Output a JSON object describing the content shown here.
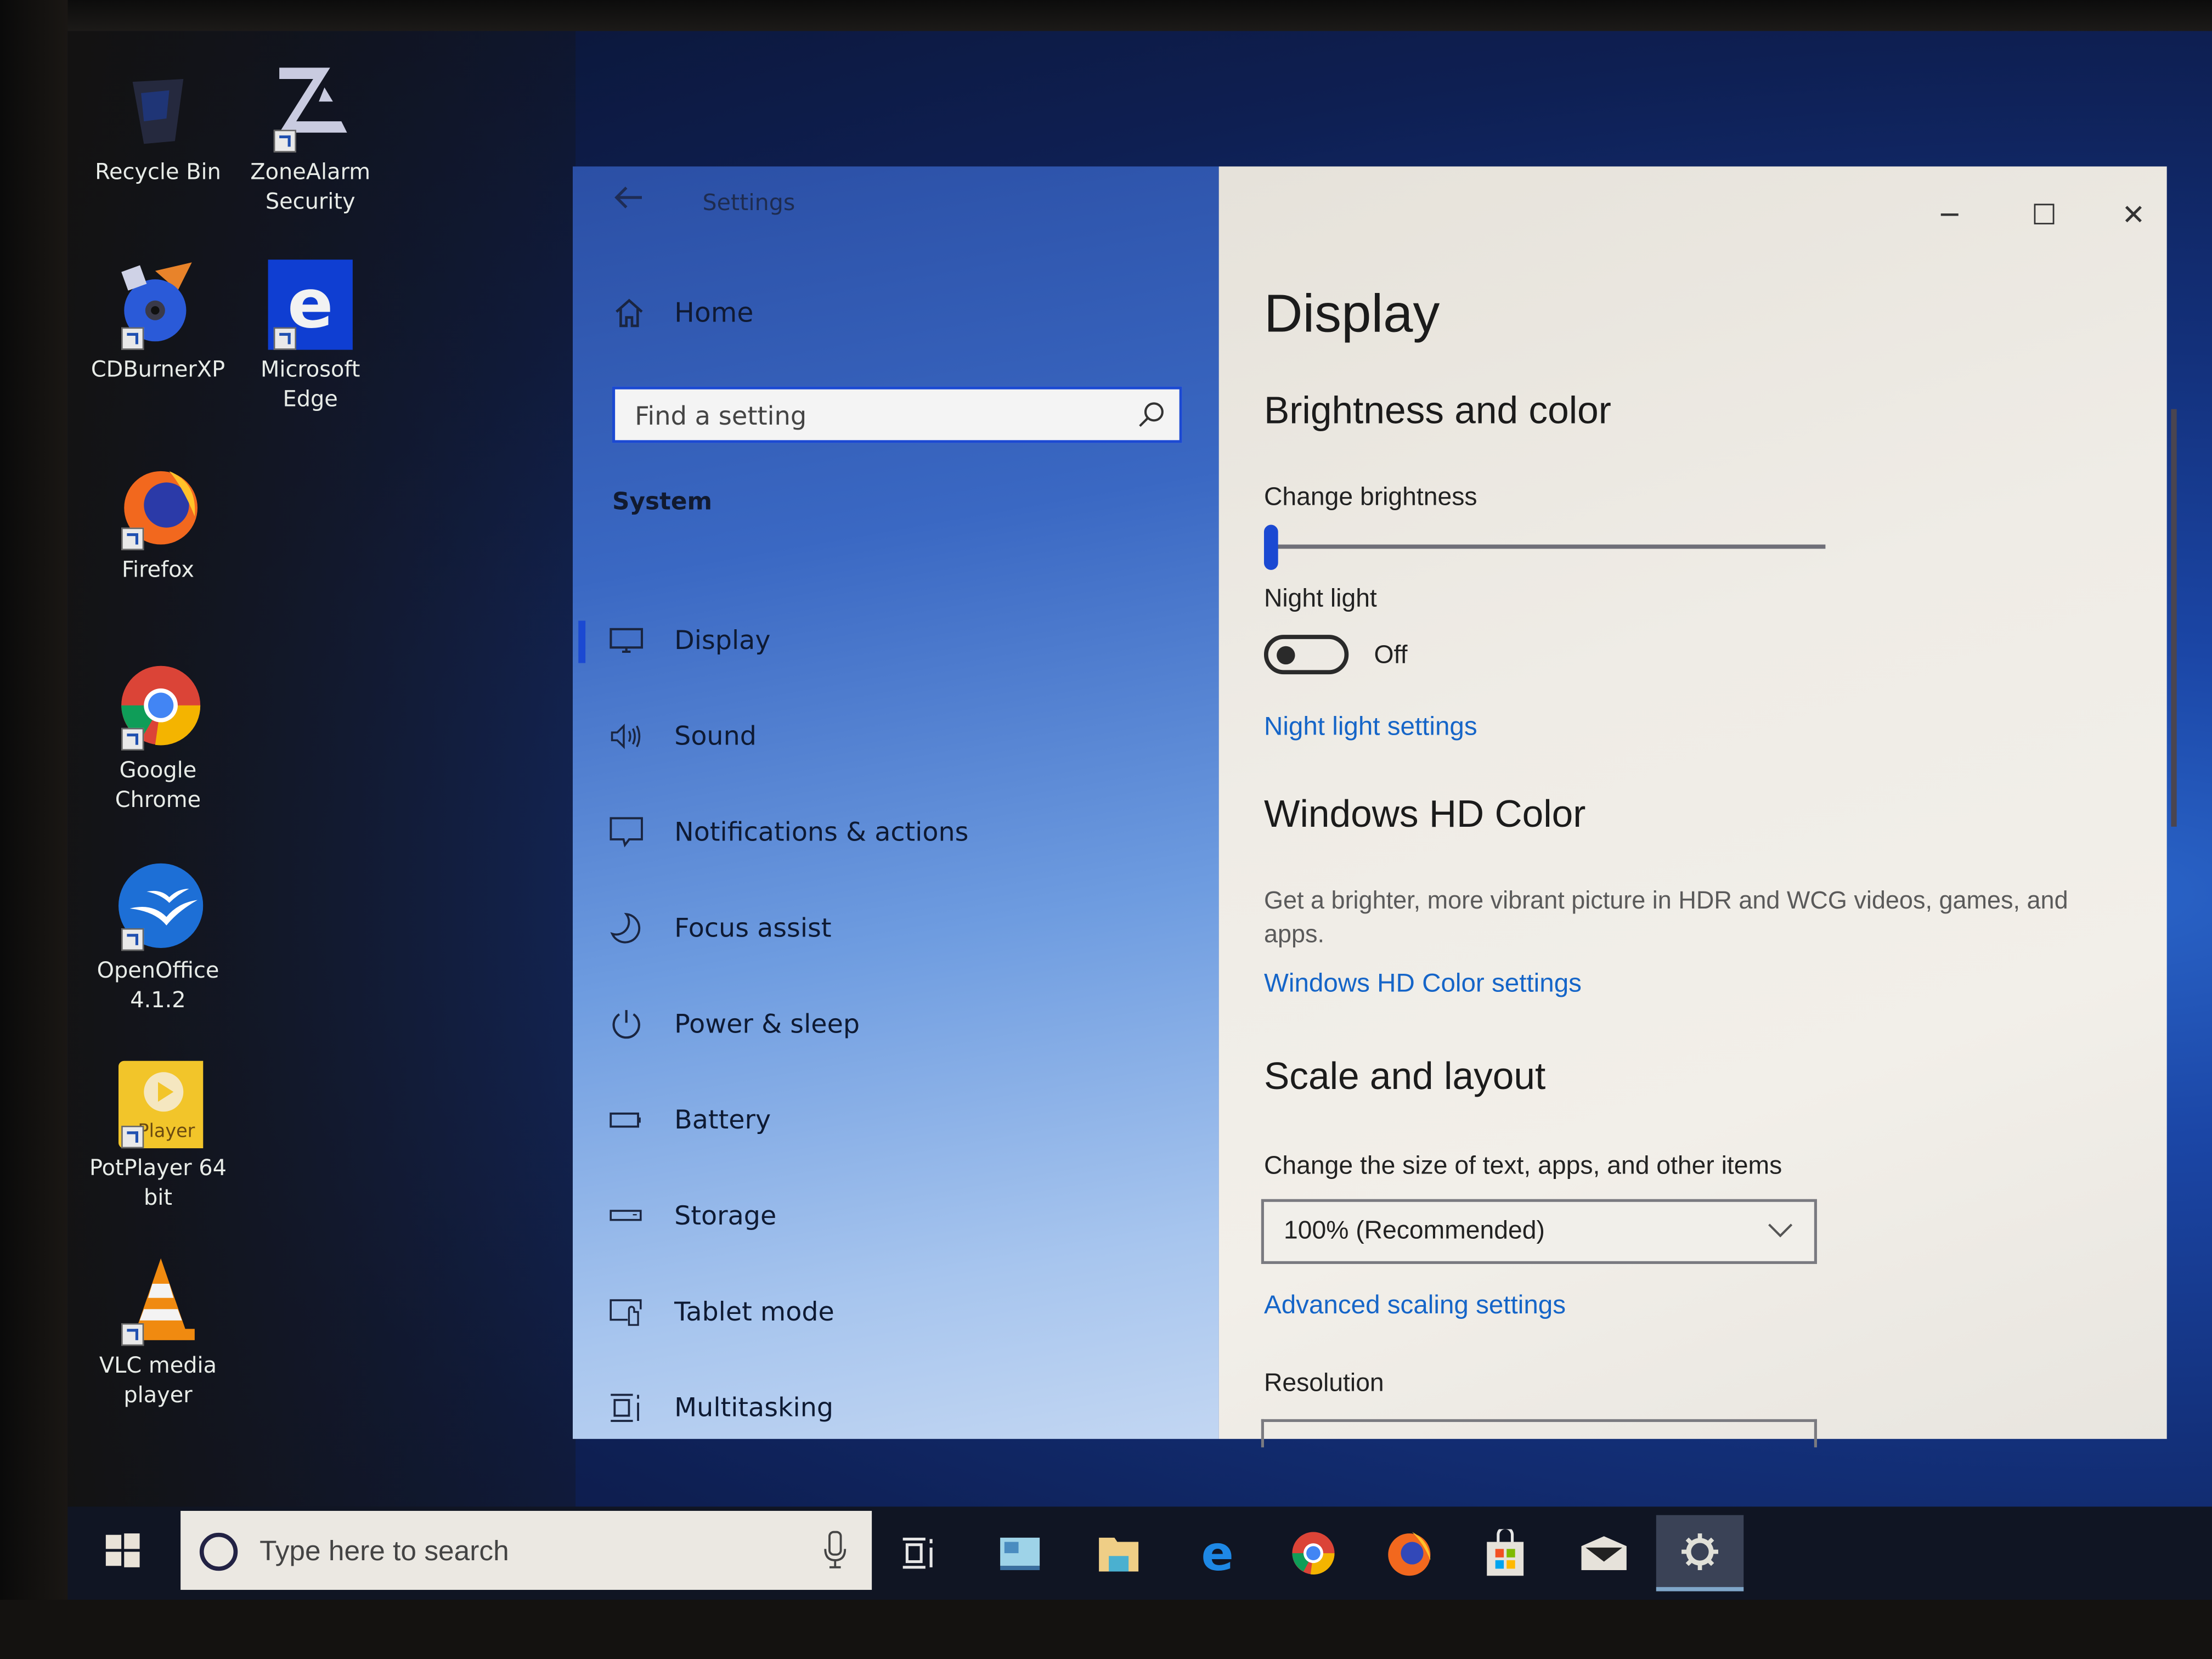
{
  "desktop": {
    "icons": [
      {
        "label": "Recycle Bin",
        "icon": "recycle-bin-icon"
      },
      {
        "label": "ZoneAlarm Security",
        "icon": "zonealarm-icon"
      },
      {
        "label": "CDBurnerXP",
        "icon": "cdburnerxp-icon"
      },
      {
        "label": "Microsoft Edge",
        "icon": "edge-icon"
      },
      {
        "label": "Firefox",
        "icon": "firefox-icon"
      },
      {
        "label": "Google Chrome",
        "icon": "chrome-icon"
      },
      {
        "label": "OpenOffice 4.1.2",
        "icon": "openoffice-icon"
      },
      {
        "label": "PotPlayer 64 bit",
        "icon": "potplayer-icon",
        "badge_text": "Player"
      },
      {
        "label": "VLC media player",
        "icon": "vlc-icon"
      }
    ]
  },
  "settings": {
    "window_title": "Settings",
    "back_icon": "back-arrow-icon",
    "window_controls": {
      "minimize": "─",
      "maximize": "☐",
      "close": "✕"
    },
    "nav": {
      "home_label": "Home",
      "search_placeholder": "Find a setting",
      "search_value": "",
      "section_label": "System",
      "items": [
        {
          "label": "Display",
          "icon": "monitor-icon",
          "active": true
        },
        {
          "label": "Sound",
          "icon": "speaker-icon",
          "active": false
        },
        {
          "label": "Notifications & actions",
          "icon": "notification-icon",
          "active": false
        },
        {
          "label": "Focus assist",
          "icon": "moon-icon",
          "active": false
        },
        {
          "label": "Power & sleep",
          "icon": "power-icon",
          "active": false
        },
        {
          "label": "Battery",
          "icon": "battery-icon",
          "active": false
        },
        {
          "label": "Storage",
          "icon": "storage-icon",
          "active": false
        },
        {
          "label": "Tablet mode",
          "icon": "tablet-mode-icon",
          "active": false
        },
        {
          "label": "Multitasking",
          "icon": "multitasking-icon",
          "active": false
        }
      ]
    },
    "content": {
      "page_title": "Display",
      "brightness_section": "Brightness and color",
      "change_brightness_label": "Change brightness",
      "brightness_value_percent": 0,
      "night_light_label": "Night light",
      "night_light_state": "Off",
      "night_light_on": false,
      "night_light_settings_link": "Night light settings",
      "hd_color_section": "Windows HD Color",
      "hd_color_description": "Get a brighter, more vibrant picture in HDR and WCG videos, games, and apps.",
      "hd_color_settings_link": "Windows HD Color settings",
      "scale_section": "Scale and layout",
      "scale_label": "Change the size of text, apps, and other items",
      "scale_value": "100% (Recommended)",
      "advanced_scaling_link": "Advanced scaling settings",
      "resolution_label": "Resolution"
    }
  },
  "taskbar": {
    "search_placeholder": "Type here to search",
    "search_value": "",
    "pinned": [
      {
        "name": "task-view",
        "icon": "task-view-icon"
      },
      {
        "name": "control-panel",
        "icon": "control-panel-icon"
      },
      {
        "name": "file-explorer",
        "icon": "folder-icon"
      },
      {
        "name": "edge",
        "icon": "edge-icon"
      },
      {
        "name": "chrome",
        "icon": "chrome-icon"
      },
      {
        "name": "firefox",
        "icon": "firefox-icon"
      },
      {
        "name": "store",
        "icon": "store-icon"
      },
      {
        "name": "mail",
        "icon": "mail-icon"
      },
      {
        "name": "settings",
        "icon": "gear-icon",
        "active": true
      }
    ]
  },
  "colors": {
    "accent": "#1b49d2",
    "link": "#1565c8"
  }
}
